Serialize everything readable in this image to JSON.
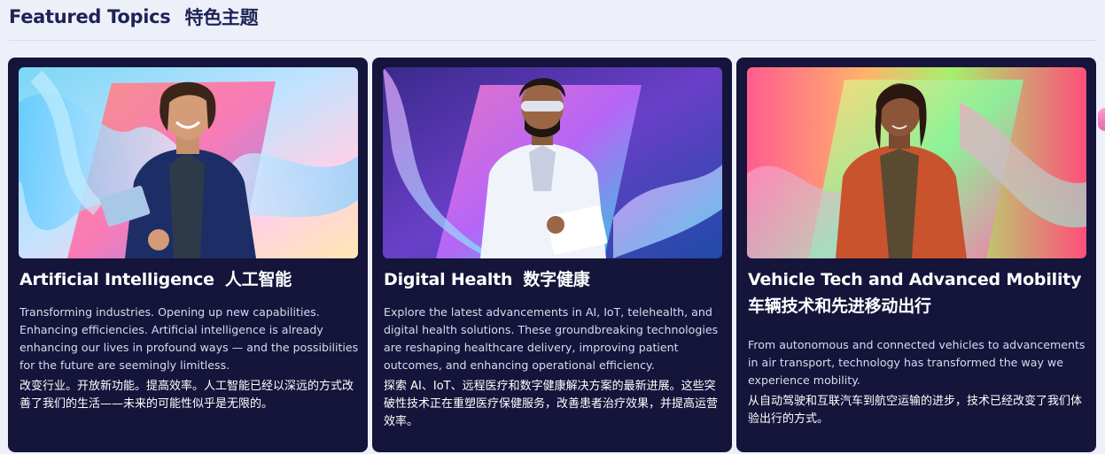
{
  "header": {
    "title_en": "Featured Topics",
    "title_zh": "特色主题"
  },
  "cards": [
    {
      "title_en": "Artificial Intelligence",
      "title_zh": "人工智能",
      "desc_en": "Transforming industries. Opening up new capabilities. Enhancing efficiencies. Artificial intelligence is already enhancing our lives in profound ways — and the possibilities for the future are seemingly limitless.",
      "desc_zh": "改变行业。开放新功能。提高效率。人工智能已经以深远的方式改善了我们的生活——未来的可能性似乎是无限的。",
      "image_subject": "smiling man in blue blazer holding tablet on holographic background"
    },
    {
      "title_en": "Digital Health",
      "title_zh": "数字健康",
      "desc_en": "Explore the latest advancements in AI, IoT, telehealth, and digital health solutions. These groundbreaking technologies are reshaping healthcare delivery, improving patient outcomes, and enhancing operational efficiency.",
      "desc_zh": "探索 AI、IoT、远程医疗和数字健康解决方案的最新进展。这些突破性技术正在重塑医疗保健服务，改善患者治疗效果，并提高运营效率。",
      "image_subject": "scientist in lab coat and safety goggles writing on clipboard"
    },
    {
      "title_en": "Vehicle Tech and Advanced Mobility",
      "title_zh": "车辆技术和先进移动出行",
      "desc_en": "From autonomous and connected vehicles to advancements in air transport, technology has transformed the way we experience mobility.",
      "desc_zh": "从自动驾驶和互联汽车到航空运输的进步，技术已经改变了我们体验出行的方式。",
      "image_subject": "woman in orange jacket on colorful holographic background"
    }
  ],
  "colors": {
    "page_bg": "#eef0f9",
    "card_bg": "#15143a",
    "heading": "#1e2257"
  }
}
